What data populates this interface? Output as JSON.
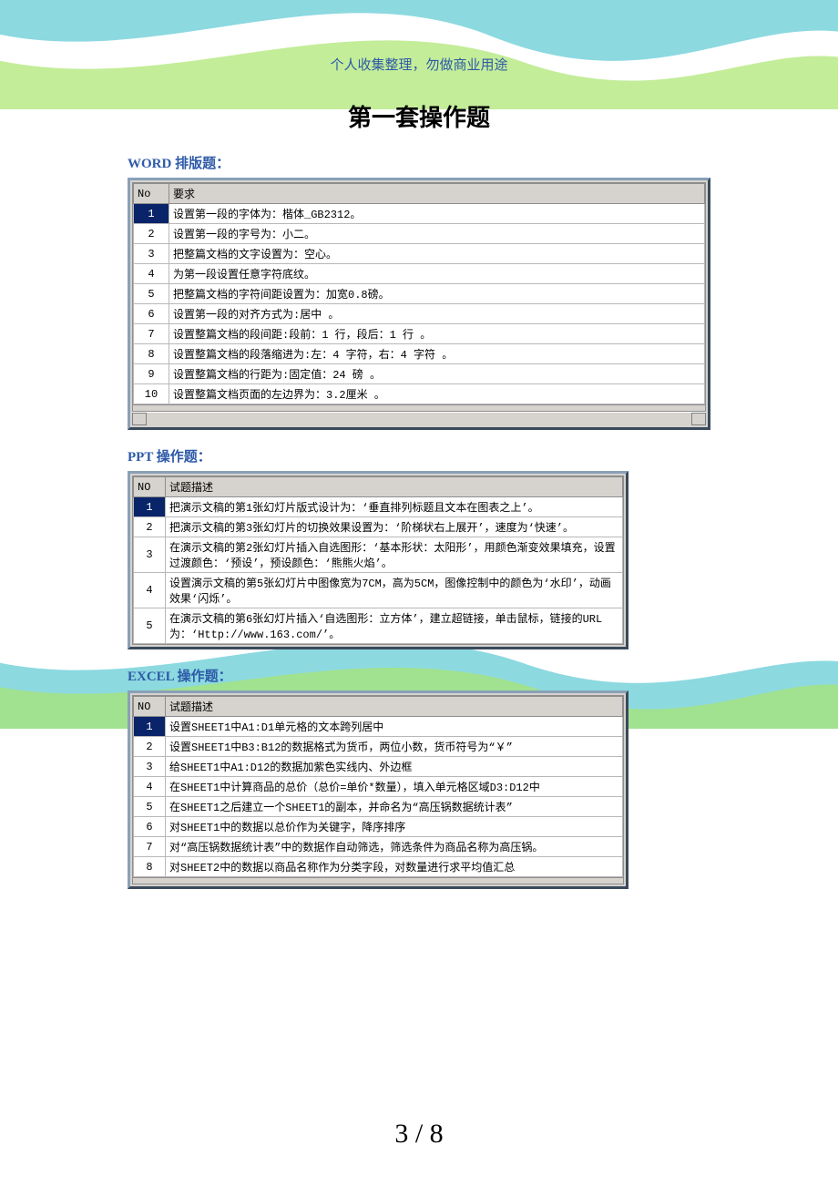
{
  "header_note": "个人收集整理，勿做商业用途",
  "title": "第一套操作题",
  "word": {
    "label": "WORD 排版题：",
    "cols": [
      "No",
      "要求"
    ],
    "rows": [
      {
        "no": "1",
        "sel": true,
        "text": "设置第一段的字体为：楷体_GB2312。"
      },
      {
        "no": "2",
        "text": "设置第一段的字号为：小二。"
      },
      {
        "no": "3",
        "text": "把整篇文档的文字设置为：空心。"
      },
      {
        "no": "4",
        "text": "为第一段设置任意字符底纹。"
      },
      {
        "no": "5",
        "text": "把整篇文档的字符间距设置为：加宽0.8磅。"
      },
      {
        "no": "6",
        "text": "设置第一段的对齐方式为:居中 。"
      },
      {
        "no": "7",
        "text": "设置整篇文档的段间距:段前：1 行，段后：1 行 。"
      },
      {
        "no": "8",
        "text": "设置整篇文档的段落缩进为:左：4 字符，右：4 字符 。"
      },
      {
        "no": "9",
        "text": "设置整篇文档的行距为:固定值：24 磅 。"
      },
      {
        "no": "10",
        "text": "设置整篇文档页面的左边界为：3.2厘米 。"
      }
    ]
  },
  "ppt": {
    "label": "PPT 操作题：",
    "cols": [
      "NO",
      "试题描述"
    ],
    "rows": [
      {
        "no": "1",
        "sel": true,
        "text": "把演示文稿的第1张幻灯片版式设计为：‘垂直排列标题且文本在图表之上’。"
      },
      {
        "no": "2",
        "text": "把演示文稿的第3张幻灯片的切换效果设置为：‘阶梯状右上展开’，速度为‘快速’。"
      },
      {
        "no": "3",
        "text": "在演示文稿的第2张幻灯片插入自选图形：‘基本形状：太阳形’，用颜色渐变效果填充，设置过渡颜色：‘预设’，预设颜色：‘熊熊火焰’。"
      },
      {
        "no": "4",
        "text": "设置演示文稿的第5张幻灯片中图像宽为7CM，高为5CM，图像控制中的颜色为‘水印’，动画效果‘闪烁’。"
      },
      {
        "no": "5",
        "text": "在演示文稿的第6张幻灯片插入‘自选图形：立方体’，建立超链接，单击鼠标，链接的URL为：‘Http://www.163.com/’。"
      }
    ]
  },
  "excel": {
    "label": "EXCEL 操作题：",
    "cols": [
      "NO",
      "试题描述"
    ],
    "rows": [
      {
        "no": "1",
        "sel": true,
        "text": "设置SHEET1中A1:D1单元格的文本跨列居中"
      },
      {
        "no": "2",
        "text": "设置SHEET1中B3:B12的数据格式为货币，两位小数，货币符号为“￥”"
      },
      {
        "no": "3",
        "text": "给SHEET1中A1:D12的数据加紫色实线内、外边框"
      },
      {
        "no": "4",
        "text": "在SHEET1中计算商品的总价（总价=单价*数量），填入单元格区域D3:D12中"
      },
      {
        "no": "5",
        "text": "在SHEET1之后建立一个SHEET1的副本，并命名为“高压锅数据统计表”"
      },
      {
        "no": "6",
        "text": "对SHEET1中的数据以总价作为关键字，降序排序"
      },
      {
        "no": "7",
        "text": "对“高压锅数据统计表”中的数据作自动筛选，筛选条件为商品名称为高压锅。"
      },
      {
        "no": "8",
        "text": "对SHEET2中的数据以商品名称作为分类字段，对数量进行求平均值汇总"
      }
    ]
  },
  "page": {
    "current": "3",
    "total": "8",
    "sep": " / "
  }
}
